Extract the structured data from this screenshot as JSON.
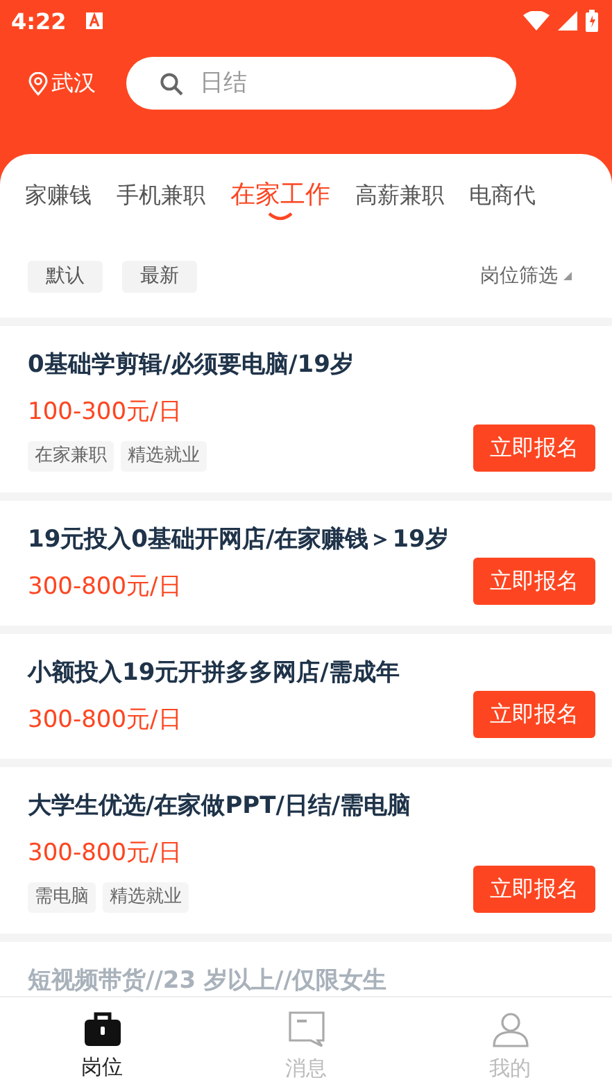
{
  "status_bar": {
    "time": "4:22"
  },
  "header": {
    "city": "武汉",
    "search": {
      "placeholder": "日结"
    }
  },
  "tabs": [
    {
      "label": "家赚钱",
      "selected": false
    },
    {
      "label": "手机兼职",
      "selected": false
    },
    {
      "label": "在家工作",
      "selected": true
    },
    {
      "label": "高薪兼职",
      "selected": false
    },
    {
      "label": "电商代",
      "selected": false
    }
  ],
  "sort": {
    "options": [
      {
        "label": "默认"
      },
      {
        "label": "最新"
      }
    ],
    "filter": "岗位筛选"
  },
  "jobs": [
    {
      "title": "0基础学剪辑/必须要电脑/19岁",
      "pay": "100-300元/日",
      "tags": [
        "在家兼职",
        "精选就业"
      ],
      "button": "立即报名",
      "faded": false
    },
    {
      "title": "19元投入0基础开网店/在家赚钱＞19岁",
      "pay": "300-800元/日",
      "button": "立即报名",
      "faded": false
    },
    {
      "title": "小额投入19元开拼多多网店/需成年",
      "pay": "300-800元/日",
      "button": "立即报名",
      "faded": false
    },
    {
      "title": "大学生优选/在家做PPT/日结/需电脑",
      "pay": "300-800元/日",
      "tags": [
        "需电脑",
        "精选就业"
      ],
      "button": "立即报名",
      "faded": false
    },
    {
      "title": "短视频带货//23 岁以上//仅限女生",
      "faded": true
    }
  ],
  "bottom_nav": [
    {
      "label": "岗位",
      "selected": true
    },
    {
      "label": "消息",
      "selected": false
    },
    {
      "label": "我的",
      "selected": false
    }
  ]
}
